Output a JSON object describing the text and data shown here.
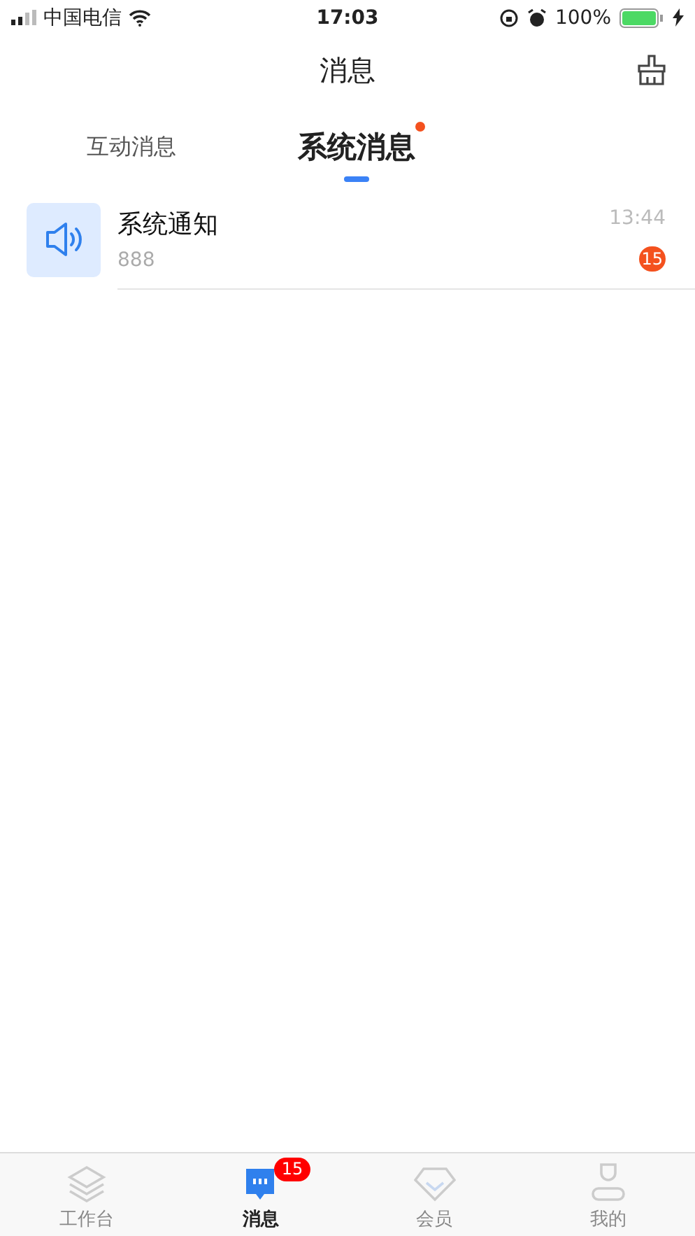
{
  "status_bar": {
    "carrier": "中国电信",
    "time": "17:03",
    "battery": "100%"
  },
  "nav": {
    "title": "消息"
  },
  "tabs": [
    {
      "label": "互动消息",
      "selected": false,
      "unread": false
    },
    {
      "label": "系统消息",
      "selected": true,
      "unread": true
    }
  ],
  "messages": [
    {
      "title": "系统通知",
      "preview": "888",
      "time": "13:44",
      "badge": "15"
    }
  ],
  "tab_bar": [
    {
      "kind": "layers",
      "label": "工作台",
      "selected": false
    },
    {
      "kind": "chat",
      "label": "消息",
      "selected": true,
      "badge": "15"
    },
    {
      "kind": "diamond",
      "label": "会员",
      "selected": false
    },
    {
      "kind": "person",
      "label": "我的",
      "selected": false
    }
  ]
}
